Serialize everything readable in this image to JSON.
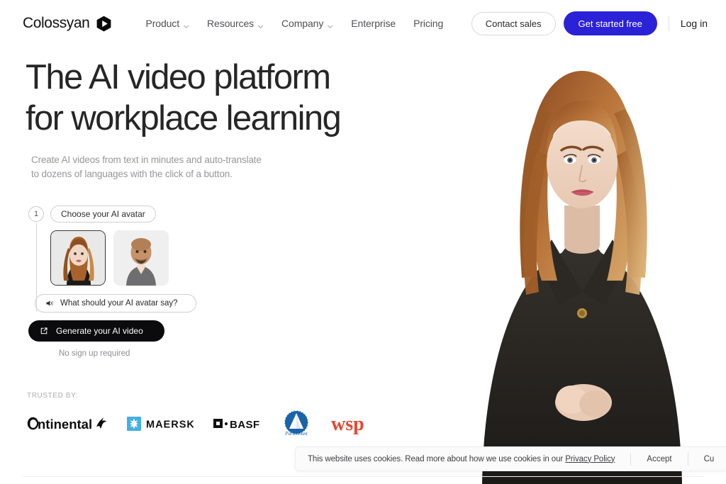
{
  "brand": {
    "name": "Colossyan",
    "mark_icon": "hexagon-play-logo"
  },
  "nav": {
    "items": [
      {
        "label": "Product",
        "has_chevron": true,
        "icon": "chevron-down-icon"
      },
      {
        "label": "Resources",
        "has_chevron": true,
        "icon": "chevron-down-icon"
      },
      {
        "label": "Company",
        "has_chevron": true,
        "icon": "chevron-down-icon"
      },
      {
        "label": "Enterprise",
        "has_chevron": false
      },
      {
        "label": "Pricing",
        "has_chevron": false
      }
    ]
  },
  "header_actions": {
    "contact_sales": "Contact sales",
    "get_started": "Get started free",
    "log_in": "Log in",
    "accent_color": "#2b22d8"
  },
  "hero": {
    "headline_line1": "The AI video platform",
    "headline_line2": "for workplace learning",
    "subhead_line1": "Create AI videos from text in minutes and auto-translate",
    "subhead_line2": "to dozens of languages with the click of a button.",
    "photo_alt": "woman-presenter-photo"
  },
  "widget": {
    "step_number": "1",
    "step_label": "Choose your AI avatar",
    "avatars": [
      {
        "name": "avatar-option-female",
        "selected": true
      },
      {
        "name": "avatar-option-male",
        "selected": false
      }
    ],
    "say_placeholder": "What should your AI avatar say?",
    "say_value": "",
    "speaker_icon": "speaker-icon",
    "generate_label": "Generate your AI video",
    "generate_icon": "external-link-icon",
    "no_signup_note": "No sign up required"
  },
  "trusted": {
    "label": "TRUSTED BY:",
    "logos": [
      {
        "name": "continental-logo",
        "text": "ntinental"
      },
      {
        "name": "maersk-logo",
        "text": "MAERSK",
        "accent": "#42b0e3"
      },
      {
        "name": "basf-logo",
        "text": "BASF"
      },
      {
        "name": "paramount-logo",
        "text": "Paramount",
        "accent": "#1b63a8"
      },
      {
        "name": "wsp-logo",
        "text": "wsp",
        "accent": "#e8462f"
      }
    ]
  },
  "cookie_banner": {
    "message": "This website uses cookies. Read more about how we use cookies in our",
    "policy_link": "Privacy Policy",
    "accept_label": "Accept",
    "customize_label": "Cu"
  }
}
